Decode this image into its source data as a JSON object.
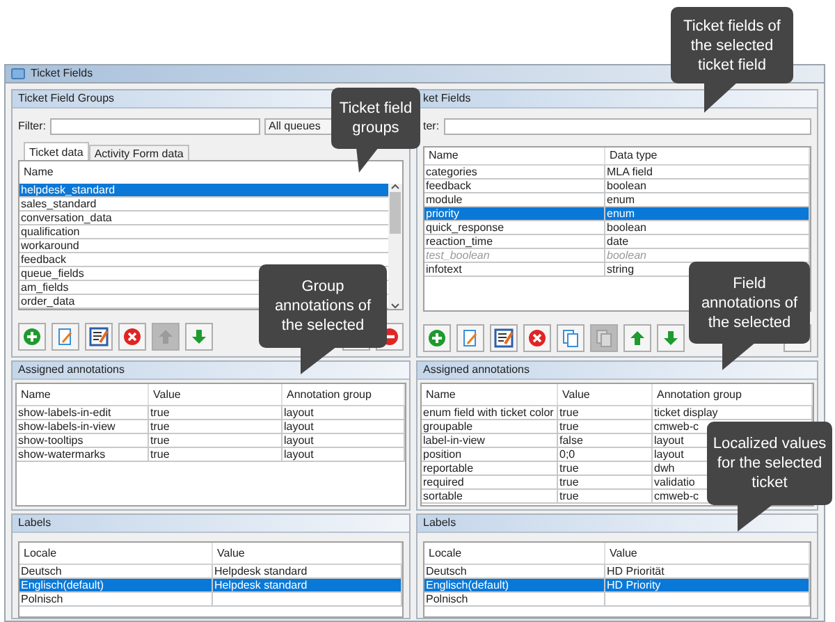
{
  "window": {
    "title": "Ticket Fields"
  },
  "groups_panel": {
    "title": "Ticket Field Groups",
    "filter_label": "Filter:",
    "queue_dropdown": "All queues",
    "tabs": [
      {
        "label": "Ticket data",
        "selected": true
      },
      {
        "label": "Activity Form data",
        "selected": false
      }
    ],
    "list": {
      "column": "Name",
      "rows": [
        {
          "name": "helpdesk_standard",
          "selected": true
        },
        {
          "name": "sales_standard",
          "selected": false
        },
        {
          "name": "conversation_data",
          "selected": false
        },
        {
          "name": "qualification",
          "selected": false
        },
        {
          "name": "workaround",
          "selected": false
        },
        {
          "name": "feedback",
          "selected": false
        },
        {
          "name": "queue_fields",
          "selected": false
        },
        {
          "name": "am_fields",
          "selected": false
        },
        {
          "name": "order_data",
          "selected": false
        }
      ]
    },
    "toolbar": {
      "left": [
        {
          "kind": "add",
          "disabled": false
        },
        {
          "kind": "edit",
          "disabled": false
        },
        {
          "kind": "properties",
          "disabled": false
        },
        {
          "kind": "delete",
          "disabled": false
        },
        {
          "kind": "up",
          "disabled": true
        },
        {
          "kind": "down",
          "disabled": false
        }
      ],
      "right": [
        {
          "kind": "blank"
        },
        {
          "kind": "remove",
          "disabled": false
        }
      ]
    }
  },
  "fields_panel": {
    "title": "ket Fields",
    "filter_label": "ter:",
    "table": {
      "columns": [
        "Name",
        "Data type"
      ],
      "rows": [
        {
          "cells": [
            "categories",
            "MLA field"
          ],
          "selected": false,
          "inactive": false
        },
        {
          "cells": [
            "feedback",
            "boolean"
          ],
          "selected": false,
          "inactive": false
        },
        {
          "cells": [
            "module",
            "enum"
          ],
          "selected": false,
          "inactive": false
        },
        {
          "cells": [
            "priority",
            "enum"
          ],
          "selected": true,
          "inactive": false
        },
        {
          "cells": [
            "quick_response",
            "boolean"
          ],
          "selected": false,
          "inactive": false
        },
        {
          "cells": [
            "reaction_time",
            "date"
          ],
          "selected": false,
          "inactive": false
        },
        {
          "cells": [
            "test_boolean",
            "boolean"
          ],
          "selected": false,
          "inactive": true
        },
        {
          "cells": [
            "infotext",
            "string"
          ],
          "selected": false,
          "inactive": false
        }
      ]
    },
    "toolbar": {
      "left": [
        {
          "kind": "add",
          "disabled": false
        },
        {
          "kind": "edit",
          "disabled": false
        },
        {
          "kind": "properties",
          "disabled": false
        },
        {
          "kind": "delete",
          "disabled": false
        },
        {
          "kind": "copy",
          "disabled": false
        },
        {
          "kind": "copy",
          "disabled": true
        },
        {
          "kind": "up",
          "disabled": false
        },
        {
          "kind": "down",
          "disabled": false
        }
      ],
      "right": [
        {
          "kind": "blank"
        }
      ]
    }
  },
  "group_annotations": {
    "title": "Assigned annotations",
    "columns": [
      "Name",
      "Value",
      "Annotation group"
    ],
    "rows": [
      [
        "show-labels-in-edit",
        "true",
        "layout"
      ],
      [
        "show-labels-in-view",
        "true",
        "layout"
      ],
      [
        "show-tooltips",
        "true",
        "layout"
      ],
      [
        "show-watermarks",
        "true",
        "layout"
      ]
    ]
  },
  "field_annotations": {
    "title": "Assigned annotations",
    "columns": [
      "Name",
      "Value",
      "Annotation group"
    ],
    "rows": [
      [
        "enum field with ticket color",
        "true",
        "ticket display"
      ],
      [
        "groupable",
        "true",
        "cmweb-c"
      ],
      [
        "label-in-view",
        "false",
        "layout"
      ],
      [
        "position",
        "0;0",
        "layout"
      ],
      [
        "reportable",
        "true",
        "dwh"
      ],
      [
        "required",
        "true",
        "validatio"
      ],
      [
        "sortable",
        "true",
        "cmweb-c"
      ]
    ]
  },
  "group_labels": {
    "title": "Labels",
    "columns": [
      "Locale",
      "Value"
    ],
    "rows": [
      {
        "cells": [
          "Deutsch",
          "Helpdesk standard"
        ],
        "selected": false
      },
      {
        "cells": [
          "Englisch(default)",
          "Helpdesk standard"
        ],
        "selected": true
      },
      {
        "cells": [
          "Polnisch",
          ""
        ],
        "selected": false
      }
    ]
  },
  "field_labels": {
    "title": "Labels",
    "columns": [
      "Locale",
      "Value"
    ],
    "rows": [
      {
        "cells": [
          "Deutsch",
          "HD Priorität"
        ],
        "selected": false
      },
      {
        "cells": [
          "Englisch(default)",
          "HD Priority"
        ],
        "selected": true
      },
      {
        "cells": [
          "Polnisch",
          ""
        ],
        "selected": false
      }
    ]
  },
  "callouts": [
    {
      "text": "Ticket field groups"
    },
    {
      "text": "Ticket fields of the selected ticket field"
    },
    {
      "text": "Group annotations of the selected"
    },
    {
      "text": "Field annotations of the selected"
    },
    {
      "text": "Localized values for the selected ticket"
    }
  ]
}
